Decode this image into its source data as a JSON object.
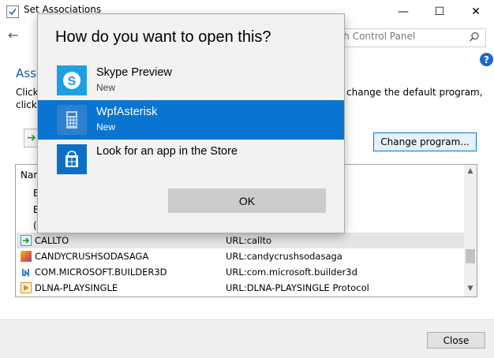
{
  "window": {
    "title": "Set Associations",
    "minimize": "—",
    "maximize": "☐",
    "close": "✕"
  },
  "nav": {
    "back": "←",
    "search_placeholder": "rch Control Panel"
  },
  "background": {
    "heading": "Asso",
    "line1_left": "Click",
    "line2_left": "click",
    "line1_right": "change the default program,",
    "change_program": "Change program..."
  },
  "list": {
    "header": "Nar",
    "partial_rows": [
      "E",
      "E",
      "("
    ],
    "rows": [
      {
        "name": "CALLTO",
        "desc": "URL:callto",
        "icon_color": "#3a9bd9"
      },
      {
        "name": "CANDYCRUSHSODASAGA",
        "desc": "URL:candycrushsodasaga",
        "icon_color": "#e36b2c"
      },
      {
        "name": "COM.MICROSOFT.BUILDER3D",
        "desc": "URL:com.microsoft.builder3d",
        "icon_color": "#1f7ac6"
      },
      {
        "name": "DLNA-PLAYSINGLE",
        "desc": "URL:DLNA-PLAYSINGLE Protocol",
        "icon_color": "#e08a1e"
      }
    ]
  },
  "footer": {
    "close_label": "Close"
  },
  "flyout": {
    "title": "How do you want to open this?",
    "apps": [
      {
        "name": "Skype Preview",
        "sub": "New",
        "icon": "skype-icon",
        "color": "#1e9fe3"
      },
      {
        "name": "WpfAsterisk",
        "sub": "New",
        "icon": "calculator-icon",
        "color": "#2e7fcf"
      },
      {
        "name": "Look for an app in the Store",
        "sub": "",
        "icon": "store-icon",
        "color": "#0b6fc6"
      }
    ],
    "ok_label": "OK"
  },
  "colors": {
    "accent": "#0a75d0",
    "link_heading": "#1e5a9c"
  }
}
